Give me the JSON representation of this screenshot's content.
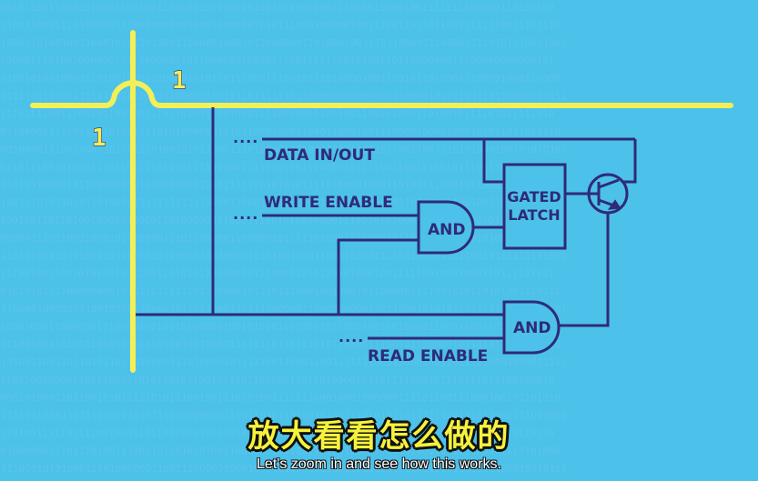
{
  "colors": {
    "background": "#4cc1ea",
    "bus_wire": "#f3ef56",
    "circuit_wire": "#2f2a7a",
    "gate_fill": "#4cc1ea",
    "subtitle_cn": "#f6f23c",
    "subtitle_en": "#ffffff"
  },
  "bus": {
    "horizontal_bit": "1",
    "vertical_bit": "1"
  },
  "signals": {
    "data": "DATA IN/OUT",
    "write_enable": "WRITE ENABLE",
    "read_enable": "READ ENABLE",
    "ellipsis": "...."
  },
  "components": {
    "and_gate_1": "AND",
    "and_gate_2": "AND",
    "latch_line1": "GATED",
    "latch_line2": "LATCH",
    "transistor": "transistor-symbol"
  },
  "subtitles": {
    "chinese": "放大看看怎么做的",
    "english": "Let's zoom in and see how this works."
  }
}
